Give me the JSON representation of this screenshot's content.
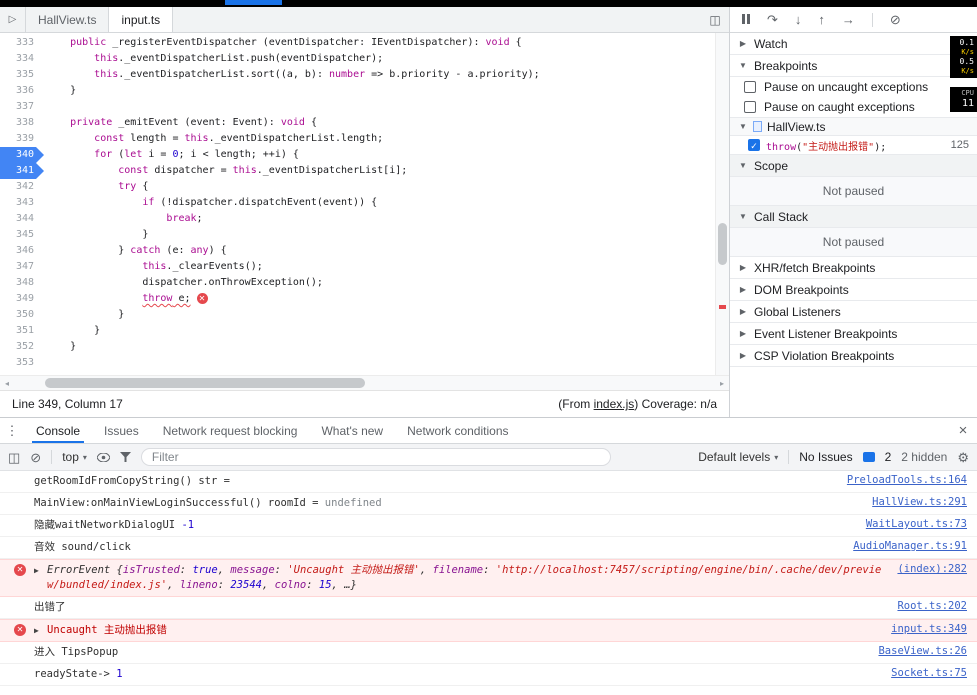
{
  "colors": {
    "accent": "#1a73e8",
    "link": "#3b63c9",
    "keyword": "#aa0d91",
    "number": "#1c00cf",
    "string": "#c41a16",
    "property": "#881391",
    "error_text": "#c00000",
    "error_bg": "#fff0f0",
    "error_border": "#ffd6d6",
    "breakpoint": "#4285f4"
  },
  "file_tabs": {
    "items": [
      {
        "label": "HallView.ts"
      },
      {
        "label": "input.ts"
      }
    ],
    "active_index": 1
  },
  "debug_toolbar": {
    "icons": [
      {
        "name": "pause-icon",
        "glyph": ""
      },
      {
        "name": "step-over-icon",
        "glyph": "↷"
      },
      {
        "name": "step-into-icon",
        "glyph": "↓"
      },
      {
        "name": "step-out-icon",
        "glyph": "↑"
      },
      {
        "name": "step-icon",
        "glyph": "→"
      },
      {
        "name": "deactivate-breakpoints-icon",
        "glyph": "⊘"
      }
    ]
  },
  "editor": {
    "lines": [
      {
        "num": 333,
        "tokens": [
          {
            "t": "    ",
            "c": "p"
          },
          {
            "t": "public",
            "c": "k"
          },
          {
            "t": " _registerEventDispatcher (eventDispatcher: IEventDispatcher): ",
            "c": "p"
          },
          {
            "t": "void",
            "c": "k"
          },
          {
            "t": " {",
            "c": "p"
          }
        ]
      },
      {
        "num": 334,
        "tokens": [
          {
            "t": "        ",
            "c": "p"
          },
          {
            "t": "this",
            "c": "k"
          },
          {
            "t": "._eventDispatcherList.push(eventDispatcher);",
            "c": "p"
          }
        ]
      },
      {
        "num": 335,
        "tokens": [
          {
            "t": "        ",
            "c": "p"
          },
          {
            "t": "this",
            "c": "k"
          },
          {
            "t": "._eventDispatcherList.sort((a, b): ",
            "c": "p"
          },
          {
            "t": "number",
            "c": "k"
          },
          {
            "t": " => b.priority - a.priority);",
            "c": "p"
          }
        ]
      },
      {
        "num": 336,
        "tokens": [
          {
            "t": "    }",
            "c": "p"
          }
        ]
      },
      {
        "num": 337,
        "tokens": []
      },
      {
        "num": 338,
        "tokens": [
          {
            "t": "    ",
            "c": "p"
          },
          {
            "t": "private",
            "c": "k"
          },
          {
            "t": " _emitEvent (event: Event): ",
            "c": "p"
          },
          {
            "t": "void",
            "c": "k"
          },
          {
            "t": " {",
            "c": "p"
          }
        ]
      },
      {
        "num": 339,
        "tokens": [
          {
            "t": "        ",
            "c": "p"
          },
          {
            "t": "const",
            "c": "k"
          },
          {
            "t": " length = ",
            "c": "p"
          },
          {
            "t": "this",
            "c": "k"
          },
          {
            "t": "._eventDispatcherList.length;",
            "c": "p"
          }
        ]
      },
      {
        "num": 340,
        "bp": true,
        "tokens": [
          {
            "t": "        ",
            "c": "p"
          },
          {
            "t": "for",
            "c": "k"
          },
          {
            "t": " (",
            "c": "p"
          },
          {
            "t": "let",
            "c": "k"
          },
          {
            "t": " i = ",
            "c": "p"
          },
          {
            "t": "0",
            "c": "n"
          },
          {
            "t": "; i < length; ++i) {",
            "c": "p"
          }
        ]
      },
      {
        "num": 341,
        "bp": true,
        "tokens": [
          {
            "t": "            ",
            "c": "p"
          },
          {
            "t": "const",
            "c": "k"
          },
          {
            "t": " dispatcher = ",
            "c": "p"
          },
          {
            "t": "this",
            "c": "k"
          },
          {
            "t": "._eventDispatcherList[i];",
            "c": "p"
          }
        ]
      },
      {
        "num": 342,
        "tokens": [
          {
            "t": "            ",
            "c": "p"
          },
          {
            "t": "try",
            "c": "k"
          },
          {
            "t": " {",
            "c": "p"
          }
        ]
      },
      {
        "num": 343,
        "tokens": [
          {
            "t": "                ",
            "c": "p"
          },
          {
            "t": "if",
            "c": "k"
          },
          {
            "t": " (!dispatcher.dispatchEvent(event)) {",
            "c": "p"
          }
        ]
      },
      {
        "num": 344,
        "tokens": [
          {
            "t": "                    ",
            "c": "p"
          },
          {
            "t": "break",
            "c": "k"
          },
          {
            "t": ";",
            "c": "p"
          }
        ]
      },
      {
        "num": 345,
        "tokens": [
          {
            "t": "                }",
            "c": "p"
          }
        ]
      },
      {
        "num": 346,
        "tokens": [
          {
            "t": "            } ",
            "c": "p"
          },
          {
            "t": "catch",
            "c": "k"
          },
          {
            "t": " (e: ",
            "c": "p"
          },
          {
            "t": "any",
            "c": "k"
          },
          {
            "t": ") {",
            "c": "p"
          }
        ]
      },
      {
        "num": 347,
        "tokens": [
          {
            "t": "                ",
            "c": "p"
          },
          {
            "t": "this",
            "c": "k"
          },
          {
            "t": "._clearEvents();",
            "c": "p"
          }
        ]
      },
      {
        "num": 348,
        "tokens": [
          {
            "t": "                dispatcher.onThrowException();",
            "c": "p"
          }
        ]
      },
      {
        "num": 349,
        "error": true,
        "tokens": [
          {
            "t": "                ",
            "c": "p"
          },
          {
            "t": "throw",
            "c": "ke"
          },
          {
            "t": " e;",
            "c": "pe"
          }
        ]
      },
      {
        "num": 350,
        "tokens": [
          {
            "t": "            }",
            "c": "p"
          }
        ]
      },
      {
        "num": 351,
        "tokens": [
          {
            "t": "        }",
            "c": "p"
          }
        ]
      },
      {
        "num": 352,
        "tokens": [
          {
            "t": "    }",
            "c": "p"
          }
        ]
      },
      {
        "num": 353,
        "tokens": []
      }
    ]
  },
  "status_bar": {
    "position": "Line 349, Column 17",
    "from_prefix": "(From ",
    "from_link": "index.js",
    "from_suffix": ") Coverage: n/a"
  },
  "sidebar": {
    "watch": {
      "label": "Watch"
    },
    "breakpoints": {
      "label": "Breakpoints",
      "pause_uncaught": "Pause on uncaught exceptions",
      "pause_caught": "Pause on caught exceptions",
      "file": "HallView.ts",
      "entry_tokens": [
        {
          "t": "throw",
          "c": "k"
        },
        {
          "t": "(",
          "c": "p"
        },
        {
          "t": "\"主动抛出报错\"",
          "c": "s"
        },
        {
          "t": ");",
          "c": "p"
        }
      ],
      "entry_line": "125",
      "entry_checked": true
    },
    "scope": {
      "label": "Scope",
      "status": "Not paused"
    },
    "call_stack": {
      "label": "Call Stack",
      "status": "Not paused"
    },
    "collapsed": [
      {
        "label": "XHR/fetch Breakpoints"
      },
      {
        "label": "DOM Breakpoints"
      },
      {
        "label": "Global Listeners"
      },
      {
        "label": "Event Listener Breakpoints"
      },
      {
        "label": "CSP Violation Breakpoints"
      }
    ]
  },
  "drawer": {
    "tabs": {
      "items": [
        "Console",
        "Issues",
        "Network request blocking",
        "What's new",
        "Network conditions"
      ],
      "active_index": 0
    },
    "toolbar": {
      "context_label": "top",
      "filter_placeholder": "Filter",
      "levels_label": "Default levels",
      "issues_label": "No Issues",
      "issues_count": "2",
      "hidden_label": "2 hidden"
    },
    "rows": [
      {
        "kind": "log",
        "segments": [
          {
            "t": "getRoomIdFromCopyString() str = ",
            "c": "p"
          }
        ],
        "link": "PreloadTools.ts:164"
      },
      {
        "kind": "log",
        "segments": [
          {
            "t": "MainView:onMainViewLoginSuccessful() roomId = ",
            "c": "p"
          },
          {
            "t": "undefined",
            "c": "undef"
          }
        ],
        "link": "HallView.ts:291"
      },
      {
        "kind": "log",
        "segments": [
          {
            "t": "隐藏waitNetworkDialogUI ",
            "c": "p"
          },
          {
            "t": "-1",
            "c": "num"
          }
        ],
        "link": "WaitLayout.ts:73"
      },
      {
        "kind": "log",
        "segments": [
          {
            "t": "音效 sound/click",
            "c": "p"
          }
        ],
        "link": "AudioManager.ts:91"
      },
      {
        "kind": "error",
        "expand": true,
        "italic": true,
        "segments": [
          {
            "t": "ErrorEvent ",
            "c": "obj"
          },
          {
            "t": "{",
            "c": "obj"
          },
          {
            "t": "isTrusted",
            "c": "key"
          },
          {
            "t": ": ",
            "c": "obj"
          },
          {
            "t": "true",
            "c": "bool"
          },
          {
            "t": ", ",
            "c": "obj"
          },
          {
            "t": "message",
            "c": "key"
          },
          {
            "t": ": ",
            "c": "obj"
          },
          {
            "t": "'Uncaught 主动抛出报错'",
            "c": "str"
          },
          {
            "t": ", ",
            "c": "obj"
          },
          {
            "t": "filename",
            "c": "key"
          },
          {
            "t": ": ",
            "c": "obj"
          },
          {
            "t": "'http://localhost:7457/scripting/engine/bin/.cache/dev/preview/bundled/index.js'",
            "c": "str"
          },
          {
            "t": ", ",
            "c": "obj"
          },
          {
            "t": "lineno",
            "c": "key"
          },
          {
            "t": ": ",
            "c": "obj"
          },
          {
            "t": "23544",
            "c": "num"
          },
          {
            "t": ", ",
            "c": "obj"
          },
          {
            "t": "colno",
            "c": "key"
          },
          {
            "t": ": ",
            "c": "obj"
          },
          {
            "t": "15",
            "c": "num"
          },
          {
            "t": ", ",
            "c": "obj"
          },
          {
            "t": "…}",
            "c": "obj"
          }
        ],
        "link": "(index):282"
      },
      {
        "kind": "log",
        "segments": [
          {
            "t": "出错了",
            "c": "p"
          }
        ],
        "link": "Root.ts:202"
      },
      {
        "kind": "error",
        "expand": true,
        "segments": [
          {
            "t": "Uncaught 主动抛出报错",
            "c": "err"
          }
        ],
        "link": "input.ts:349"
      },
      {
        "kind": "log",
        "segments": [
          {
            "t": "进入 TipsPopup",
            "c": "p"
          }
        ],
        "link": "BaseView.ts:26"
      },
      {
        "kind": "log",
        "segments": [
          {
            "t": "readyState-> ",
            "c": "p"
          },
          {
            "t": "1",
            "c": "num"
          }
        ],
        "link": "Socket.ts:75"
      }
    ]
  },
  "stats": {
    "net1_value": "0.1",
    "net1_unit": "K/s",
    "net2_value": "0.5",
    "net2_unit": "K/s",
    "cpu_label": "CPU",
    "cpu_value": "11"
  }
}
